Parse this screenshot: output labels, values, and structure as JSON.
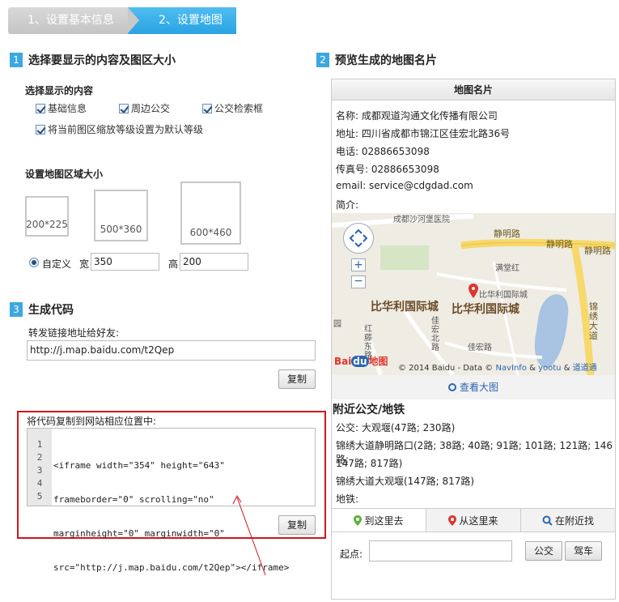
{
  "steps": {
    "step1": "1、设置基本信息",
    "step2": "2、设置地图"
  },
  "section1": {
    "num": "1",
    "title": "选择要显示的内容及图区大小",
    "content_title": "选择显示的内容",
    "checkboxes": [
      "基础信息",
      "周边公交",
      "公交检索框",
      "将当前图区缩放等级设置为默认等级"
    ],
    "size_title": "设置地图区域大小",
    "sizes": [
      "200*225",
      "500*360",
      "600*460"
    ],
    "custom_label": "自定义",
    "width_label": "宽",
    "width_value": "350",
    "height_label": "高",
    "height_value": "200"
  },
  "section2": {
    "num": "2",
    "title": "预览生成的地图名片"
  },
  "section3": {
    "num": "3",
    "title": "生成代码",
    "share_label": "转发链接地址给好友:",
    "share_url": "http://j.map.baidu.com/t2Qep",
    "copy_label": "复制",
    "code_label": "将代码复制到网站相应位置中:",
    "line_numbers": [
      "1",
      "2",
      "3",
      "4",
      "5"
    ],
    "code_lines": [
      "<iframe width=\"354\" height=\"643\"",
      "frameborder=\"0\" scrolling=\"no\"",
      "marginheight=\"0\" marginwidth=\"0\"",
      "src=\"http://j.map.baidu.com/t2Qep\"></iframe>",
      ""
    ]
  },
  "card": {
    "header": "地图名片",
    "name": "名称: 成都观道沟通文化传播有限公司",
    "address": "地址: 四川省成都市锦江区佳宏北路36号",
    "phone": "电话: 02886653098",
    "fax": "传真号: 02886653098",
    "email": "email: service@cdgdad.com",
    "intro": "简介:",
    "map": {
      "labels": {
        "road_top": "成都沙河堡医院",
        "jingming1": "静明路",
        "jingming2": "静明路",
        "jingming3": "静明路",
        "mantang": "满堂红",
        "poi": "比华利国际城",
        "bigname1": "比华利国际城",
        "bigname2": "比华利国际城",
        "jinxiu": "锦绣大道",
        "jiahong": "佳宏路",
        "jiaxiang": "佳宏北路",
        "bank": "红藤东路",
        "yuan": "园",
        "copyright": "© 2014 Baidu - Data ©",
        "navinfo": "NavInfo",
        "amp": "&",
        "yootu": "yootu",
        "amp2": "&",
        "daodao": "道道通",
        "logo_bai": "Bai",
        "logo_du": "du",
        "logo_map": "地图"
      }
    },
    "view_large": "查看大图",
    "nearby_title": "附近公交/地铁",
    "bus1": "公交: 大观堰(47路; 230路)",
    "bus2": "锦绣大道静明路口(2路; 38路; 40路; 91路; 101路; 121路; 146路;",
    "bus3": "147路; 817路)",
    "bus4": "锦绣大道大观堰(147路; 817路)",
    "subway": "地铁:",
    "tabs": [
      "到这里去",
      "从这里来",
      "在附近找"
    ],
    "start_label": "起点:",
    "bus_btn": "公交",
    "drive_btn": "驾车"
  }
}
